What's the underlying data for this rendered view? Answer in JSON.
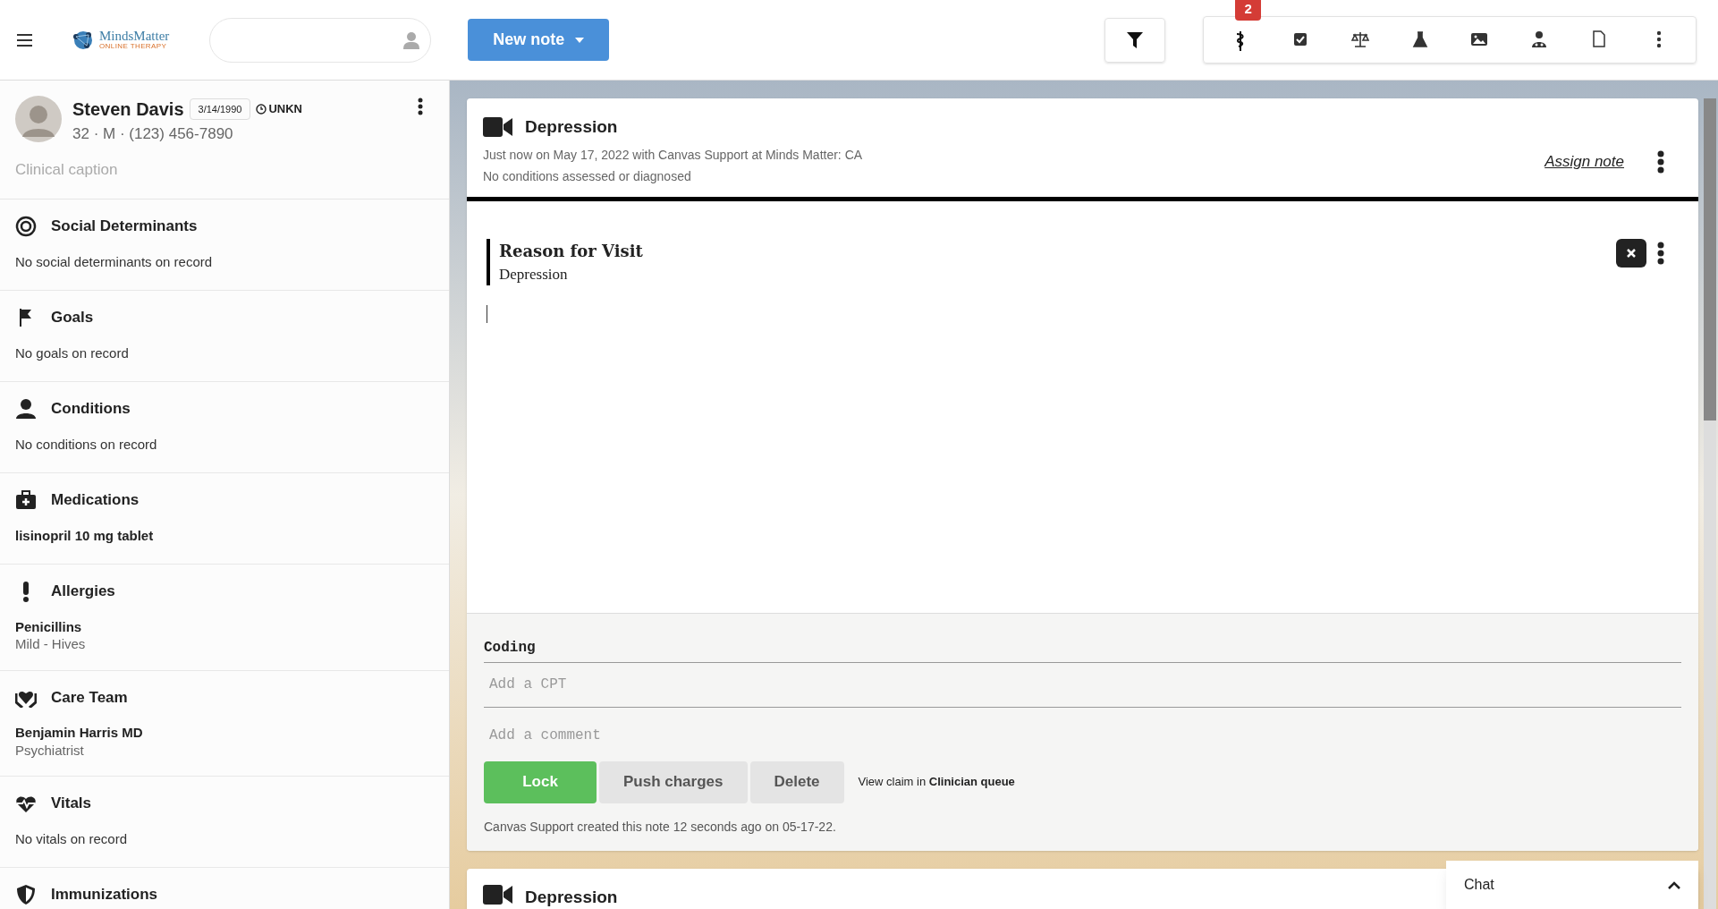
{
  "header": {
    "logo": {
      "name": "MindsMatter",
      "tagline": "ONLINE THERAPY"
    },
    "new_note": "New note",
    "toolbar": {
      "badge": "2"
    }
  },
  "patient": {
    "name": "Steven Davis",
    "dob": "3/14/1990",
    "timezone": "UNKN",
    "details": "32 · M · (123) 456-7890",
    "caption_placeholder": "Clinical caption"
  },
  "sections": [
    {
      "title": "Social Determinants",
      "items": [
        {
          "kind": "empty",
          "text": "No social determinants on record"
        }
      ]
    },
    {
      "title": "Goals",
      "items": [
        {
          "kind": "empty",
          "text": "No goals on record"
        }
      ]
    },
    {
      "title": "Conditions",
      "items": [
        {
          "kind": "empty",
          "text": "No conditions on record"
        }
      ]
    },
    {
      "title": "Medications",
      "items": [
        {
          "kind": "entry",
          "text": "lisinopril 10 mg tablet"
        }
      ]
    },
    {
      "title": "Allergies",
      "items": [
        {
          "kind": "entry",
          "text": "Penicillins",
          "sub": "Mild - Hives"
        }
      ]
    },
    {
      "title": "Care Team",
      "items": [
        {
          "kind": "entry",
          "text": "Benjamin Harris MD",
          "sub": "Psychiatrist"
        }
      ]
    },
    {
      "title": "Vitals",
      "items": [
        {
          "kind": "empty",
          "text": "No vitals on record"
        }
      ]
    },
    {
      "title": "Immunizations"
    }
  ],
  "note": {
    "title": "Depression",
    "meta": "Just now on May 17, 2022 with Canvas Support at Minds Matter: CA",
    "conditions": "No conditions assessed or diagnosed",
    "assign": "Assign note",
    "command": {
      "title": "Reason for Visit",
      "value": "Depression"
    },
    "coding": {
      "label": "Coding",
      "cpt_placeholder": "Add a CPT",
      "comment_placeholder": "Add a comment"
    },
    "buttons": [
      {
        "label": "Lock",
        "kind": "primary"
      },
      {
        "label": "Push charges",
        "kind": "secondary"
      },
      {
        "label": "Delete",
        "kind": "secondary"
      }
    ],
    "claim": "View claim in **Clinician queue**",
    "created": "Canvas Support created this note 12 seconds ago on 05-17-22."
  },
  "next_note": {
    "title": "Depression"
  },
  "chat": {
    "label": "Chat"
  }
}
